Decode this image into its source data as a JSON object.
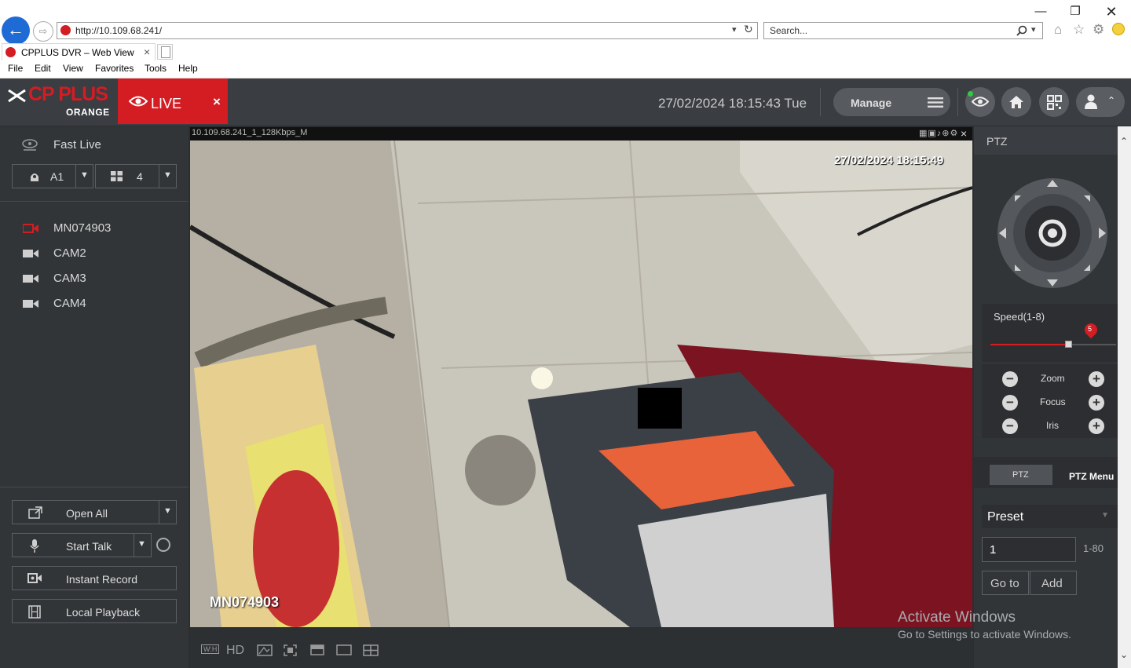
{
  "browser": {
    "url": "http://10.109.68.241/",
    "search_placeholder": "Search...",
    "tab_title": "CPPLUS DVR – Web View",
    "menu": [
      "File",
      "Edit",
      "View",
      "Favorites",
      "Tools",
      "Help"
    ]
  },
  "header": {
    "brand_line1": "CP PLUS",
    "brand_line2": "ORANGE",
    "live_label": "LIVE",
    "close_glyph": "×",
    "datetime": "27/02/2024 18:15:43 Tue",
    "manage_label": "Manage"
  },
  "left_panel": {
    "fast_live_label": "Fast Live",
    "stream_select": "A1",
    "layout_select": "4",
    "cameras": [
      "MN074903",
      "CAM2",
      "CAM3",
      "CAM4"
    ],
    "active_camera_color": "#d41c23",
    "buttons": {
      "open_all": "Open All",
      "start_talk": "Start Talk",
      "instant_record": "Instant Record",
      "local_playback": "Local Playback"
    }
  },
  "video": {
    "stream_info": "10.109.68.241_1_128Kbps_M",
    "osd_timestamp": "27/02/2024 18:15:49",
    "osd_camera_name": "MN074903",
    "toolbar": [
      "W:H",
      "HD"
    ]
  },
  "right_panel": {
    "title": "PTZ",
    "speed_label": "Speed(1-8)",
    "speed_value": "5",
    "speed_fraction": 0.62,
    "controls": [
      "Zoom",
      "Focus",
      "Iris"
    ],
    "tabs": [
      "PTZ",
      "PTZ Menu"
    ],
    "preset_select": "Preset",
    "preset_value": "1",
    "preset_range": "1-80",
    "goto_label": "Go to",
    "add_label": "Add"
  },
  "watermark": {
    "line1": "Activate Windows",
    "line2": "Go to Settings to activate Windows."
  },
  "colors": {
    "accent": "#d41c23",
    "header_bg": "#3a3d41",
    "panel_bg": "#323538"
  }
}
